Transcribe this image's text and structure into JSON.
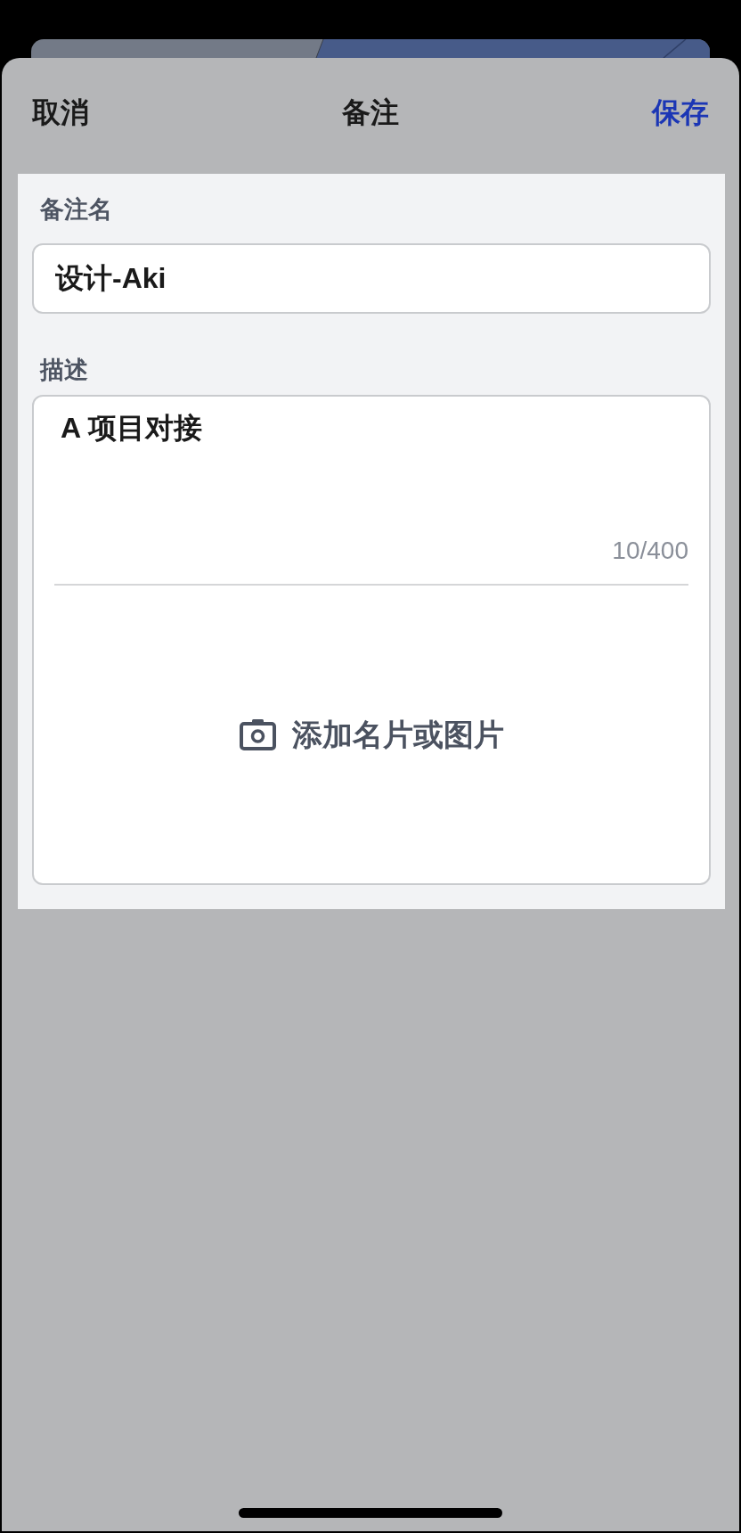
{
  "header": {
    "cancel_button": "取消",
    "title": "备注",
    "save_button": "保存"
  },
  "name_field": {
    "label": "备注名",
    "value": "设计-Aki"
  },
  "description_field": {
    "label": "描述",
    "value": "A 项目对接",
    "counter": "10/400"
  },
  "attachment_button": {
    "label": "添加名片或图片"
  }
}
